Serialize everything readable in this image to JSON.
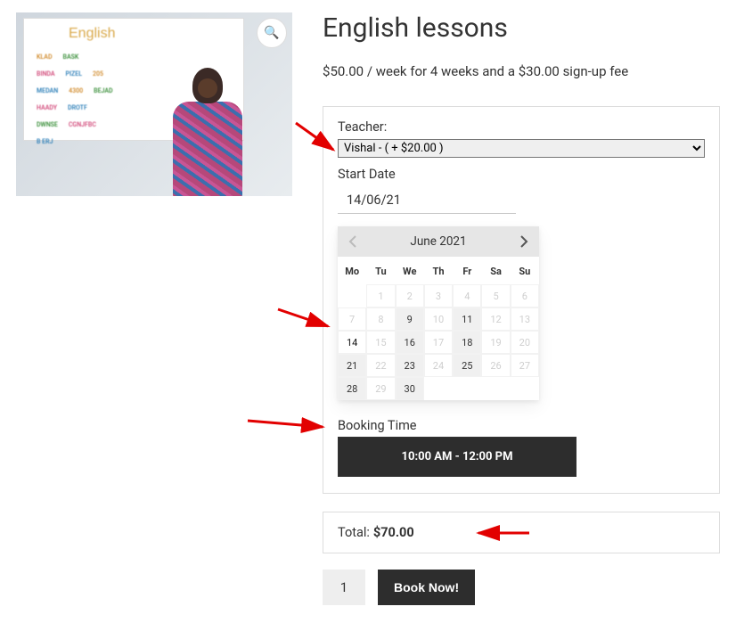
{
  "product": {
    "title": "English lessons",
    "price_line_prefix": "$",
    "price_amount": "50.00",
    "price_line_suffix": " / week for 4 weeks and a ",
    "signup_fee": "$30.00",
    "signup_fee_suffix": " sign-up fee",
    "whiteboard_title": "English"
  },
  "booking": {
    "teacher_label": "Teacher:",
    "teacher_selected": "Vishal - ( + $20.00 )",
    "start_date_label": "Start Date",
    "start_date_value": "14/06/21",
    "booking_time_label": "Booking Time",
    "time_slot": "10:00 AM - 12:00 PM",
    "calendar": {
      "title": "June 2021",
      "dow": [
        "Mo",
        "Tu",
        "We",
        "Th",
        "Fr",
        "Sa",
        "Su"
      ],
      "rows": [
        [
          {
            "n": "",
            "state": "empty"
          },
          {
            "n": "1",
            "state": "inactive"
          },
          {
            "n": "2",
            "state": "inactive"
          },
          {
            "n": "3",
            "state": "inactive"
          },
          {
            "n": "4",
            "state": "inactive"
          },
          {
            "n": "5",
            "state": "inactive"
          },
          {
            "n": "6",
            "state": "inactive"
          }
        ],
        [
          {
            "n": "7",
            "state": "inactive"
          },
          {
            "n": "8",
            "state": "inactive"
          },
          {
            "n": "9",
            "state": "avail"
          },
          {
            "n": "10",
            "state": "inactive"
          },
          {
            "n": "11",
            "state": "avail"
          },
          {
            "n": "12",
            "state": "inactive"
          },
          {
            "n": "13",
            "state": "inactive"
          }
        ],
        [
          {
            "n": "14",
            "state": "selected"
          },
          {
            "n": "15",
            "state": "inactive"
          },
          {
            "n": "16",
            "state": "avail"
          },
          {
            "n": "17",
            "state": "inactive"
          },
          {
            "n": "18",
            "state": "avail"
          },
          {
            "n": "19",
            "state": "inactive"
          },
          {
            "n": "20",
            "state": "inactive"
          }
        ],
        [
          {
            "n": "21",
            "state": "avail"
          },
          {
            "n": "22",
            "state": "inactive"
          },
          {
            "n": "23",
            "state": "avail"
          },
          {
            "n": "24",
            "state": "inactive"
          },
          {
            "n": "25",
            "state": "avail"
          },
          {
            "n": "26",
            "state": "inactive"
          },
          {
            "n": "27",
            "state": "inactive"
          }
        ],
        [
          {
            "n": "28",
            "state": "avail"
          },
          {
            "n": "29",
            "state": "inactive"
          },
          {
            "n": "30",
            "state": "avail"
          },
          {
            "n": "",
            "state": "empty"
          },
          {
            "n": "",
            "state": "empty"
          },
          {
            "n": "",
            "state": "empty"
          },
          {
            "n": "",
            "state": "empty"
          }
        ]
      ]
    }
  },
  "total": {
    "label": "Total:",
    "value": "$70.00"
  },
  "buy": {
    "qty": "1",
    "button": "Book Now!"
  },
  "icons": {
    "zoom": "🔍"
  }
}
